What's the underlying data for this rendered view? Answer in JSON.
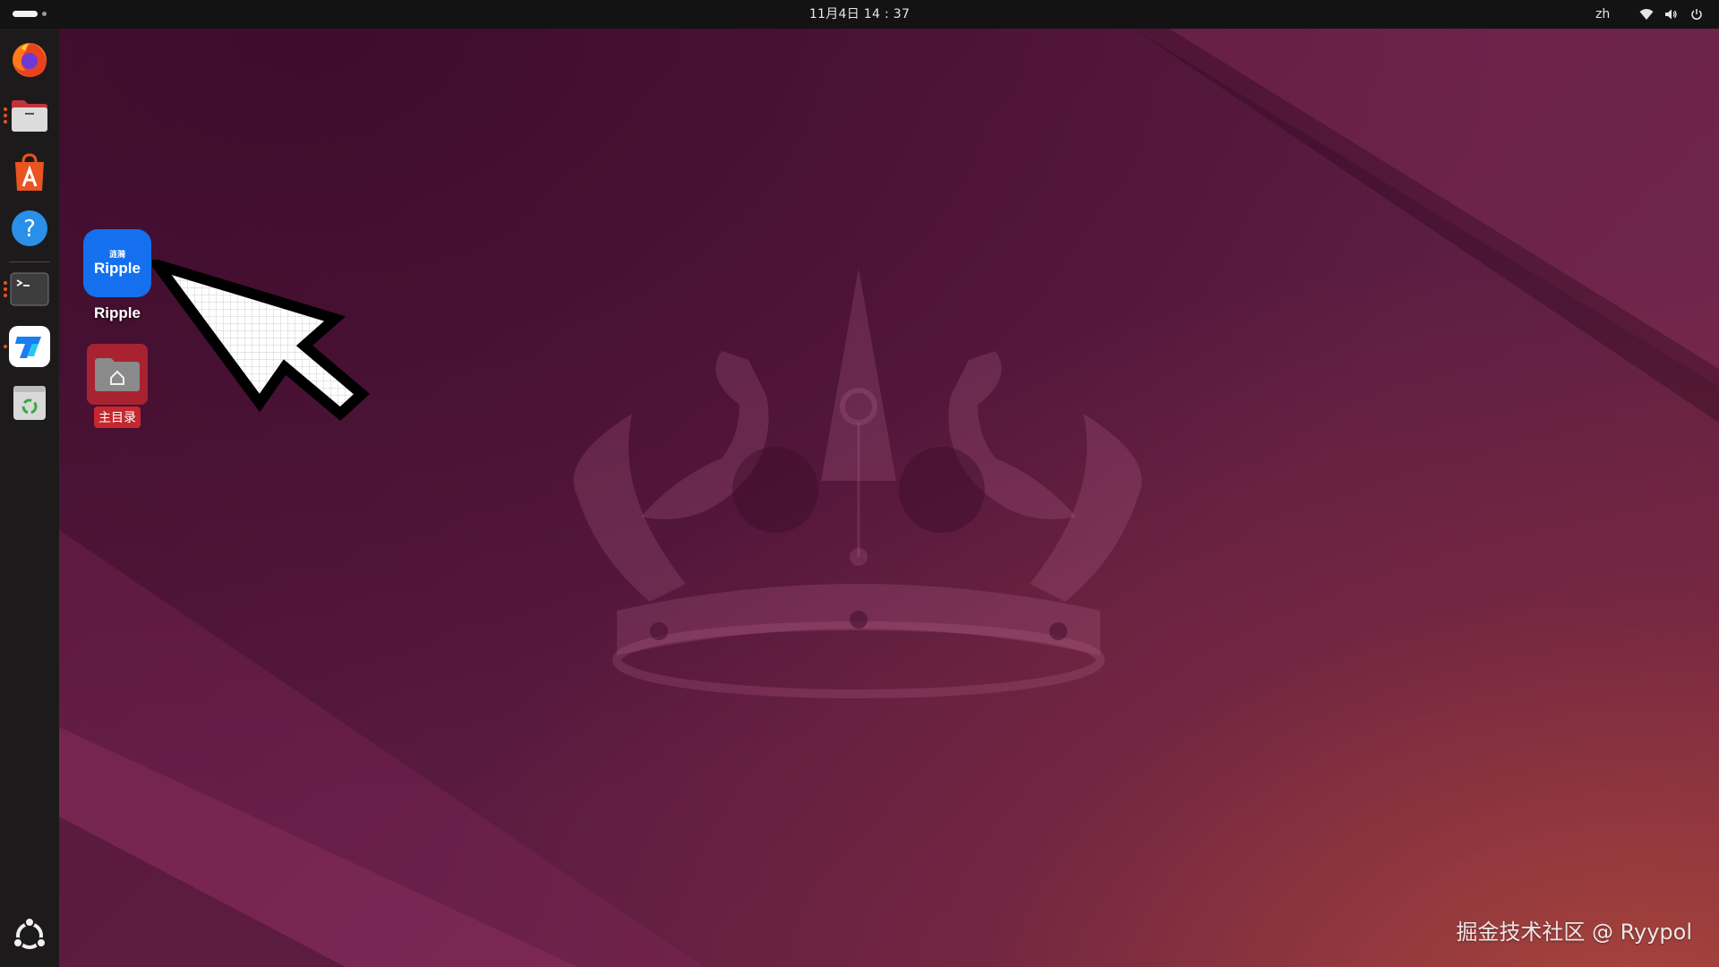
{
  "topbar": {
    "clock": "11月4日  14 : 37",
    "language": "zh",
    "tray_icons": [
      "wifi-icon",
      "volume-icon",
      "power-icon"
    ]
  },
  "dock": {
    "items": [
      {
        "name": "firefox",
        "icon": "firefox-icon"
      },
      {
        "name": "files",
        "icon": "files-icon"
      },
      {
        "name": "app-center",
        "icon": "app-center-icon"
      },
      {
        "name": "help",
        "icon": "help-icon"
      },
      {
        "name": "terminal",
        "icon": "terminal-icon"
      },
      {
        "name": "todesk",
        "icon": "todesk-icon"
      },
      {
        "name": "trash",
        "icon": "trash-icon"
      }
    ],
    "show_apps_icon": "show-apps-icon"
  },
  "desktop": {
    "icons": [
      {
        "label": "Ripple",
        "tile_small": "涟漪",
        "tile_big": "Ripple",
        "icon": "ripple-app-icon"
      },
      {
        "label": "主目录",
        "icon": "home-folder-icon"
      }
    ],
    "watermark": "掘金技术社区 @ Ryypol"
  },
  "colors": {
    "topbar": "#131313",
    "dock": "#1d1a1c",
    "accent": "#e95420",
    "ripple_blue": "#1470ee",
    "home_red": "#c5282e"
  }
}
